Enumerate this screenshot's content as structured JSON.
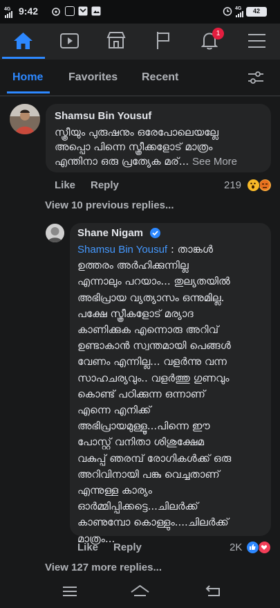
{
  "status_bar": {
    "time": "9:42",
    "signal_left": "4G",
    "signal_right": "4G",
    "battery": "42"
  },
  "top_nav": {
    "items": [
      {
        "name": "home-icon"
      },
      {
        "name": "watch-icon"
      },
      {
        "name": "marketplace-icon"
      },
      {
        "name": "pages-flag-icon"
      },
      {
        "name": "notifications-bell-icon"
      },
      {
        "name": "menu-icon"
      }
    ],
    "notification_count": "1",
    "accent_color": "#2d88ff"
  },
  "tabs": {
    "items": [
      "Home",
      "Favorites",
      "Recent"
    ],
    "active": "Home"
  },
  "comment": {
    "author": "Shamsu Bin  Yousuf",
    "text": "സ്ത്രീയും പുരുഷനും ഒരേപോലെയല്ലേ\nഅപ്പൊ പിന്നെ സ്ത്രീക്കളോട് മാത്രം\nഎന്തിനാ ഒരു പ്രത്യേക മര്...",
    "see_more": "See More",
    "like": "Like",
    "reply": "Reply",
    "reaction_count": "219"
  },
  "view_previous": "View 10 previous replies...",
  "reply": {
    "author": "Shane Nigam",
    "mention": "Shamsu Bin  Yousuf",
    "text_first": "  : താങ്കൾ",
    "text_rest": "ഉത്തരം അർഹിക്കുന്നില്ല\nഎന്നാലും പറയാം... തുല്യതയിൽ\nഅഭിപ്രായ വ്യത്യാസം ഒന്നുമില്ല.\nപക്ഷേ സ്ത്രീകളോട് മര്യാദ\nകാണിക്കുക എന്നൊരു അറിവ്\nഉണ്ടാകാൻ സ്വന്തമായി പെങ്ങൾ\nവേണം എന്നില്ല... വളർന്നു വന്ന\nസാഹചര്യവും.. വളർത്തു ഗുണവും\nകൊണ്ട് പഠിക്കുന്ന ഒന്നാണ്\nഎന്നെ എനിക്ക്\nഅഭിപ്രായമുള്ളൂ...പിന്നെ ഈ\nപോസ്റ്റ് വനിതാ ശിശുക്ഷേമ\nവകുപ്പ് ഞരമ്പ് രോഗികൾക്ക് ഒരു\nഅറിവിനായി പങ്കു വെച്ചതാണ്\nഎന്നുള്ള കാര്യം\nഓർമ്മിപ്പിക്കട്ടെ...ചിലർക്ക്\nകാണുമ്പോ കൊള്ളും....ചിലർക്ക്\nമാത്രം...",
    "like": "Like",
    "reply": "Reply",
    "reaction_count": "2K"
  },
  "view_more": "View 127 more replies...",
  "system_nav": {
    "items": [
      "recent-apps-icon",
      "home-button-icon",
      "back-icon"
    ]
  }
}
